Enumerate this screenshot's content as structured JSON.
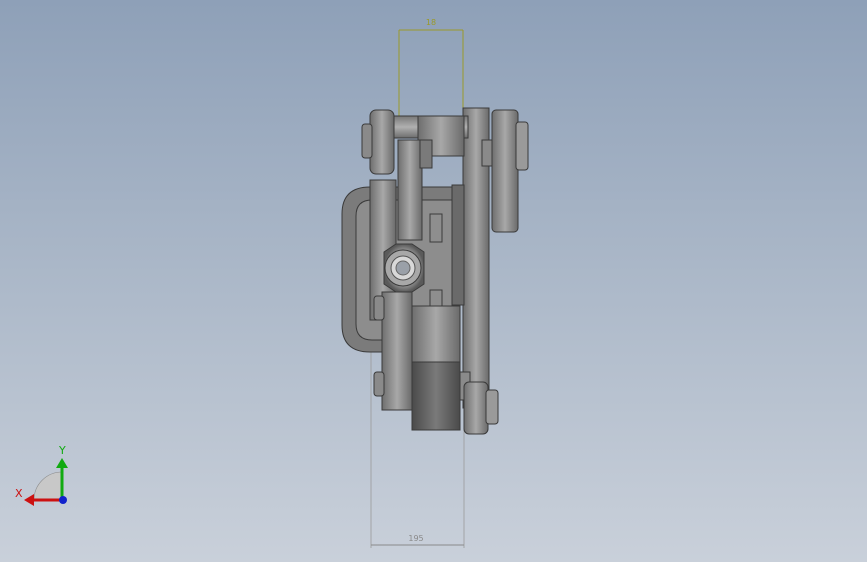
{
  "viewport": {
    "background_top": "#8ea0b8",
    "background_bottom": "#c9d0da"
  },
  "dimensions": {
    "top_value": "18",
    "bottom_value": "195",
    "top_color": "#9a9a2a",
    "bottom_color": "#8a8a8a"
  },
  "triad": {
    "x_label": "X",
    "y_label": "Y",
    "x_color": "#cc1111",
    "y_color": "#11aa11",
    "z_color": "#1122cc"
  },
  "model": {
    "part_fill": "#8a8a8a",
    "part_edge": "#3a3a3a"
  }
}
